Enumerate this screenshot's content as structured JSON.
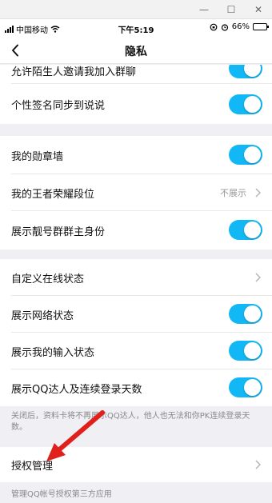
{
  "window": {
    "minimize_glyph": "—",
    "maximize_glyph": "☐",
    "close_glyph": "✕"
  },
  "status_bar": {
    "carrier": "中国移动",
    "time": "下午5:19",
    "battery": "66%",
    "battery_level": 0.66
  },
  "nav": {
    "title": "隐私",
    "back_icon": "chevron-left-icon"
  },
  "toggle_color": "#12b7f5",
  "rows": {
    "stranger_invite": {
      "label": "允许陌生人邀请我加入群聊",
      "enabled": true
    },
    "signature_sync": {
      "label": "个性签名同步到说说",
      "enabled": true
    },
    "medal_wall": {
      "label": "我的勋章墙",
      "enabled": true
    },
    "honor_rank": {
      "label": "我的王者荣耀段位",
      "value": "不展示"
    },
    "group_owner": {
      "label": "展示靓号群群主身份",
      "enabled": true
    },
    "custom_status": {
      "label": "自定义在线状态"
    },
    "network_status": {
      "label": "展示网络状态",
      "enabled": true
    },
    "input_status": {
      "label": "展示我的输入状态",
      "enabled": true
    },
    "qq_master": {
      "label": "展示QQ达人及连续登录天数",
      "enabled": true
    },
    "auth_manage": {
      "label": "授权管理"
    }
  },
  "notes": {
    "qq_master_note": "关闭后，资料卡将不再展示QQ达人，他人也无法和你PK连续登录天数。",
    "auth_note": "管理QQ帐号授权第三方应用"
  },
  "annotation_color": "#e0201b"
}
